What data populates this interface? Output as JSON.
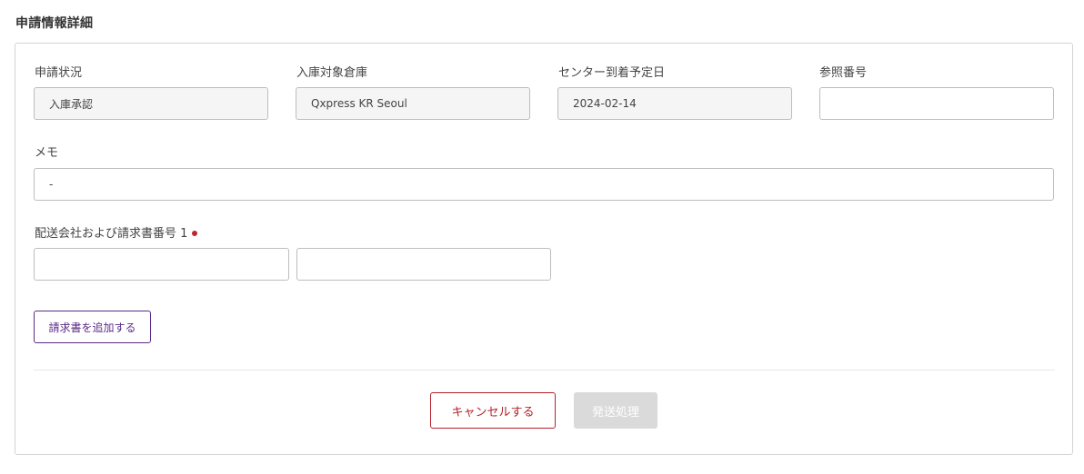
{
  "page": {
    "title": "申請情報詳細"
  },
  "fields": {
    "status": {
      "label": "申請状況",
      "value": "入庫承認"
    },
    "warehouse": {
      "label": "入庫対象倉庫",
      "value": "Qxpress KR Seoul"
    },
    "arrival_date": {
      "label": "センター到着予定日",
      "value": "2024-02-14"
    },
    "reference": {
      "label": "参照番号",
      "value": ""
    },
    "memo": {
      "label": "メモ",
      "value": "-"
    },
    "carrier_invoice": {
      "label": "配送会社および請求書番号 1",
      "carrier_value": "",
      "invoice_value": "",
      "required": true
    }
  },
  "buttons": {
    "add_invoice": "請求書を追加する",
    "cancel": "キャンセルする",
    "ship": "発送処理"
  },
  "colors": {
    "accent_purple": "#5b2a86",
    "cancel_red": "#b5212a",
    "required_red": "#c0262d",
    "disabled_gray": "#dadada"
  }
}
